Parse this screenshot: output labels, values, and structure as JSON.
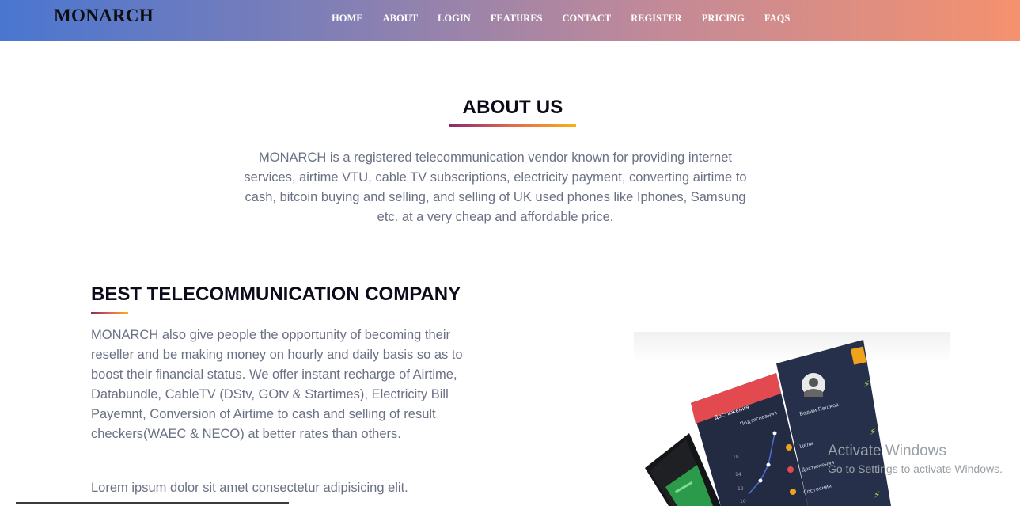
{
  "header": {
    "logo": "MONARCH",
    "nav": [
      {
        "label": "HOME"
      },
      {
        "label": "ABOUT"
      },
      {
        "label": "LOGIN"
      },
      {
        "label": "FEATURES"
      },
      {
        "label": "CONTACT"
      },
      {
        "label": "REGISTER"
      },
      {
        "label": "PRICING"
      },
      {
        "label": "FAQS"
      }
    ]
  },
  "about": {
    "title": "ABOUT US",
    "text": "MONARCH is a registered telecommunication vendor known for providing internet services, airtime VTU, cable TV subscriptions, electricity payment, converting airtime to cash, bitcoin buying and selling, and selling of UK used phones like Iphones, Samsung etc. at a very cheap and affordable price."
  },
  "section": {
    "title": "BEST TELECOMMUNICATION COMPANY",
    "text": "MONARCH also give people the opportunity of becoming their reseller and be making money on hourly and daily basis so as to boost their financial status. We offer instant recharge of Airtime, Databundle, CableTV (DStv, GOtv & Startimes), Electricity Bill Payemnt, Conversion of Airtime to cash and selling of result checkers(WAEC & NECO) at better rates than others.",
    "lorem": "Lorem ipsum dolor sit amet consectetur adipisicing elit."
  },
  "phone_app": {
    "red_tab_label": "Достижения",
    "list_header": "Подтягивания",
    "profile_name": "Вадим Пешков",
    "menu_items": [
      "Цели",
      "Достижения",
      "Состояния"
    ],
    "axis_labels": [
      "18",
      "14",
      "12",
      "10"
    ]
  },
  "watermark": {
    "line1": "Activate Windows",
    "line2": "Go to Settings to activate Windows."
  },
  "colors": {
    "header_gradient_start": "#4a76d0",
    "header_gradient_end": "#f5916e",
    "underline_start": "#8a2a6e",
    "underline_end": "#f4b21a",
    "body_text": "#6b7184"
  }
}
